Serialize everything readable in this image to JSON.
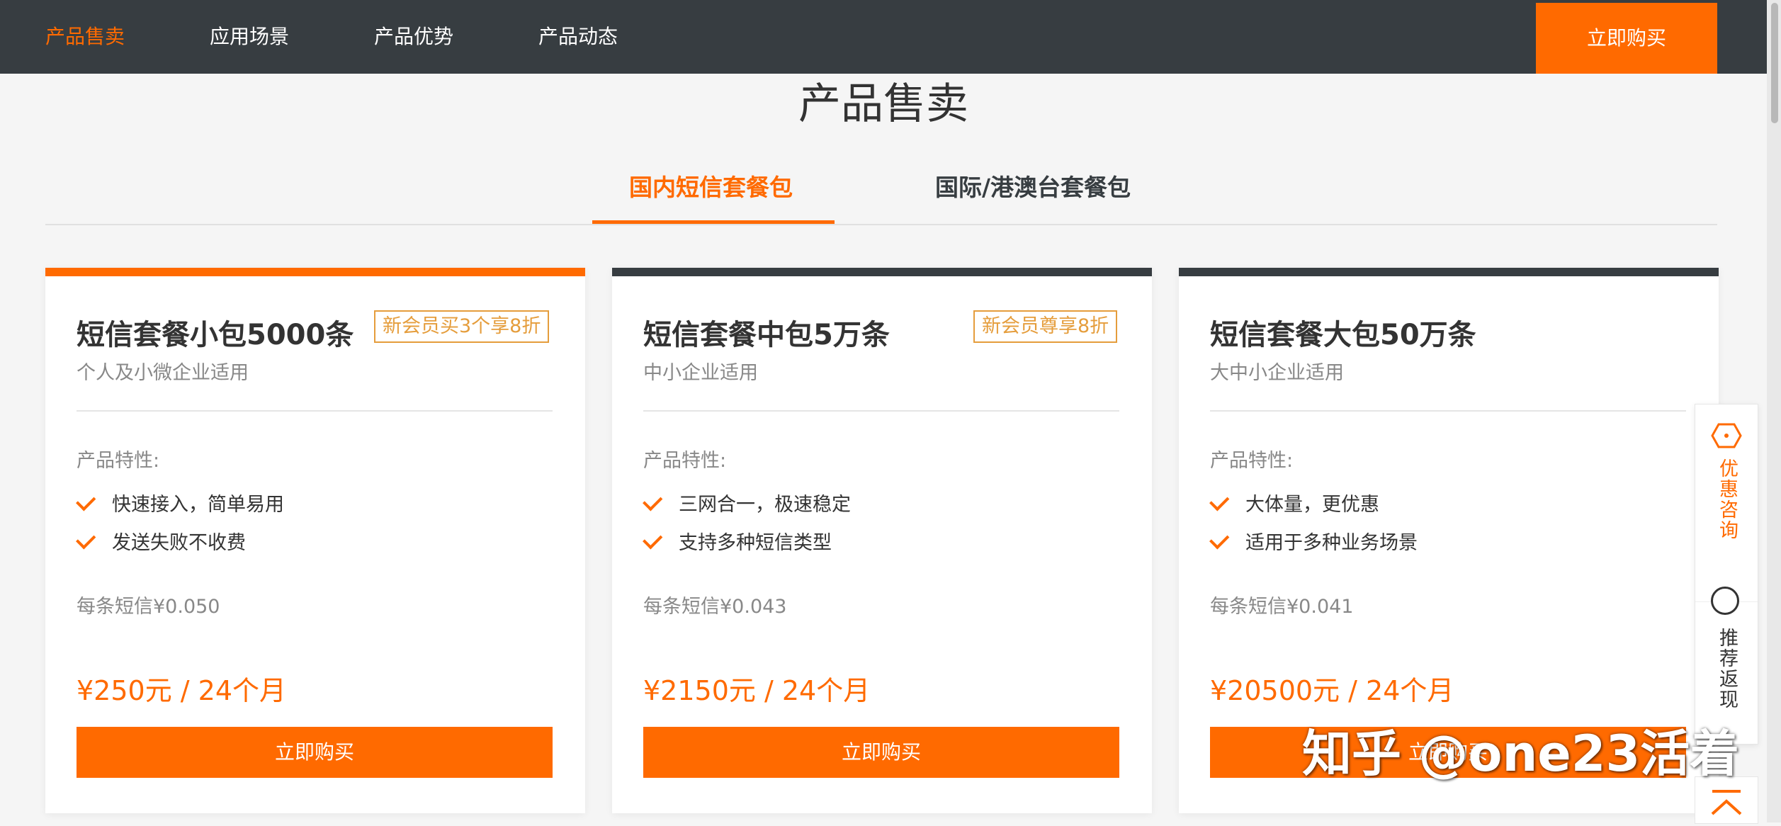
{
  "nav": {
    "items": [
      "产品售卖",
      "应用场景",
      "产品优势",
      "产品动态"
    ],
    "buy_label": "立即购买"
  },
  "section": {
    "title": "产品售卖"
  },
  "tabs": [
    {
      "label": "国内短信套餐包",
      "active": true
    },
    {
      "label": "国际/港澳台套餐包",
      "active": false
    }
  ],
  "cards": [
    {
      "title": "短信套餐小包5000条",
      "badge": "新会员买3个享8折",
      "subtitle": "个人及小微企业适用",
      "features_label": "产品特性:",
      "features": [
        "快速接入，简单易用",
        "发送失败不收费"
      ],
      "unit_price": "每条短信¥0.050",
      "price": "¥250元 / 24个月",
      "buy_label": "立即购买"
    },
    {
      "title": "短信套餐中包5万条",
      "badge": "新会员尊享8折",
      "subtitle": "中小企业适用",
      "features_label": "产品特性:",
      "features": [
        "三网合一，极速稳定",
        "支持多种短信类型"
      ],
      "unit_price": "每条短信¥0.043",
      "price": "¥2150元 / 24个月",
      "buy_label": "立即购买"
    },
    {
      "title": "短信套餐大包50万条",
      "badge": "",
      "subtitle": "大中小企业适用",
      "features_label": "产品特性:",
      "features": [
        "大体量，更优惠",
        "适用于多种业务场景"
      ],
      "unit_price": "每条短信¥0.041",
      "price": "¥20500元 / 24个月",
      "buy_label": "立即购买"
    }
  ],
  "float": {
    "consult_label": "优惠咨询",
    "referral_label": "推荐返现"
  },
  "watermark": "知乎 @one23活着",
  "colors": {
    "accent": "#ff6a00",
    "nav_bg": "#373d41",
    "badge": "#e59d3c"
  }
}
